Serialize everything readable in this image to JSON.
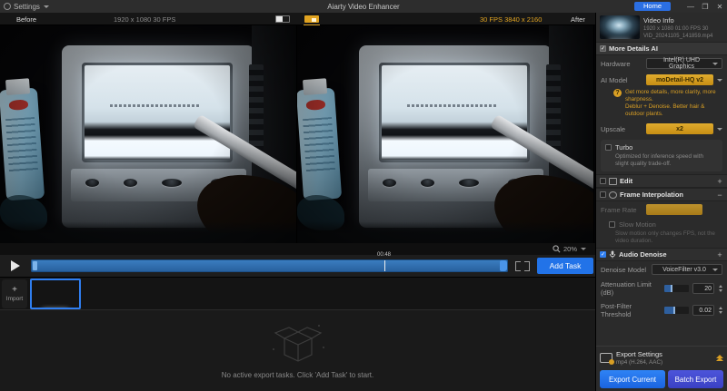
{
  "titlebar": {
    "settings_label": "Settings",
    "app_title": "Aiarty Video Enhancer",
    "home_label": "Home"
  },
  "icons": {
    "minimize": "—",
    "maximize": "❐",
    "close": "✕",
    "plus": "+",
    "minus": "−",
    "check": "✓",
    "help": "?",
    "import_plus": "+"
  },
  "compare": {
    "before_label": "Before",
    "before_meta": "1920 x 1080  30 FPS",
    "after_meta": "30 FPS  3840 x 2160",
    "after_label": "After"
  },
  "viewer": {
    "zoom_level": "20%"
  },
  "timeline": {
    "current_time": "00:48",
    "add_task_label": "Add Task",
    "import_label": "Import"
  },
  "export_queue": {
    "empty_text": "No active export tasks. Click 'Add Task' to start."
  },
  "sidebar": {
    "video_info": {
      "title": "Video Info",
      "line1": "1920 x 1080  01:00  FPS 30",
      "line2": "VID_20241105_141859.mp4"
    },
    "more_details": {
      "title": "More Details AI",
      "hardware_label": "Hardware",
      "hardware_value": "Intel(R) UHD Graphics",
      "ai_model_label": "AI Model",
      "ai_model_value": "moDetail-HQ  v2",
      "ai_model_desc1": "Get more details, more clarity, more sharpness.",
      "ai_model_desc2": "Deblur + Denoise. Better hair & outdoor plants.",
      "upscale_label": "Upscale",
      "upscale_value": "x2",
      "turbo_label": "Turbo",
      "turbo_desc": "Optimized for inference speed with slight quality trade-off."
    },
    "edit_section": {
      "title": "Edit"
    },
    "frame_interp": {
      "title": "Frame Interpolation",
      "frame_rate_label": "Frame Rate",
      "slow_motion_label": "Slow Motion",
      "slow_motion_desc": "Slow motion only changes FPS, not the video duration."
    },
    "audio_denoise": {
      "title": "Audio Denoise",
      "model_label": "Denoise Model",
      "model_value": "VoiceFilter v3.0",
      "attenuation_label": "Attenuation Limit (dB)",
      "attenuation_value": "20",
      "threshold_label": "Post-Filter Threshold",
      "threshold_value": "0.02"
    },
    "export": {
      "title": "Export Settings",
      "format": "mp4 (H.264, AAC)",
      "export_current": "Export Current",
      "batch_export": "Batch Export"
    }
  },
  "colors": {
    "accent_orange": "#d99f24",
    "accent_blue": "#2273e8",
    "timeline_blue": "#2e6db8"
  }
}
